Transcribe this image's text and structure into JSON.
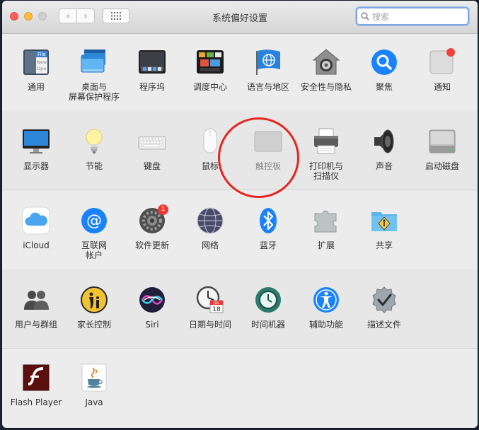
{
  "window": {
    "title": "系统偏好设置"
  },
  "search": {
    "placeholder": "搜索"
  },
  "sections": [
    {
      "items": [
        {
          "label": "通用"
        },
        {
          "label": "桌面与\n屏幕保护程序"
        },
        {
          "label": "程序坞"
        },
        {
          "label": "调度中心"
        },
        {
          "label": "语言与地区"
        },
        {
          "label": "安全性与隐私"
        },
        {
          "label": "聚焦"
        },
        {
          "label": "通知"
        }
      ]
    },
    {
      "items": [
        {
          "label": "显示器"
        },
        {
          "label": "节能"
        },
        {
          "label": "键盘"
        },
        {
          "label": "鼠标"
        },
        {
          "label": "触控板"
        },
        {
          "label": "打印机与\n扫描仪"
        },
        {
          "label": "声音"
        },
        {
          "label": "启动磁盘"
        }
      ]
    },
    {
      "items": [
        {
          "label": "iCloud"
        },
        {
          "label": "互联网\n帐户"
        },
        {
          "label": "软件更新",
          "badge": "1"
        },
        {
          "label": "网络"
        },
        {
          "label": "蓝牙"
        },
        {
          "label": "扩展"
        },
        {
          "label": "共享"
        }
      ]
    },
    {
      "items": [
        {
          "label": "用户与群组"
        },
        {
          "label": "家长控制"
        },
        {
          "label": "Siri"
        },
        {
          "label": "日期与时间",
          "calendar": {
            "month": "JUL",
            "day": "18"
          }
        },
        {
          "label": "时间机器"
        },
        {
          "label": "辅助功能"
        },
        {
          "label": "描述文件"
        }
      ]
    },
    {
      "items": [
        {
          "label": "Flash Player"
        },
        {
          "label": "Java"
        }
      ]
    }
  ],
  "general_icon_text": [
    "File",
    "New",
    "Ope"
  ],
  "colors": {
    "accent": "#1a82fb",
    "annotation": "#e5261f"
  }
}
